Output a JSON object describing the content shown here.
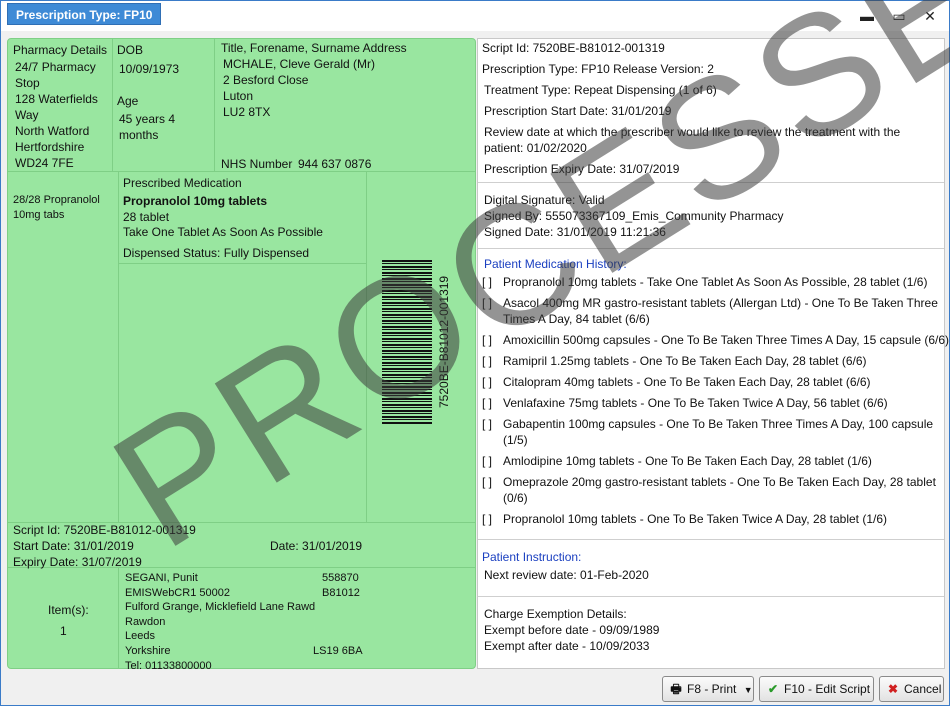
{
  "window": {
    "title": "Prescription Type: FP10",
    "minimize_icon": "▬",
    "maximize_icon": "▭",
    "close_icon": "✕"
  },
  "pharmacy": {
    "header": "Pharmacy Details",
    "lines": [
      "24/7 Pharmacy",
      "Stop",
      "128 Waterfields",
      "Way",
      "North Watford",
      "Hertfordshire",
      "WD24 7FE"
    ]
  },
  "patient": {
    "dob_label": "DOB",
    "dob": "10/09/1973",
    "age_label": "Age",
    "age_line1": "45 years 4",
    "age_line2": "months",
    "name_header": "Title, Forename, Surname Address",
    "name": "MCHALE, Cleve Gerald (Mr)",
    "address": [
      "2 Besford Close",
      "Luton",
      "LU2 8TX"
    ],
    "nhs_label": "NHS Number",
    "nhs_number": "944 637 0876"
  },
  "dispensed": {
    "line1": "28/28 Propranolol",
    "line2": "10mg tabs"
  },
  "medication": {
    "header": "Prescribed Medication",
    "name": "Propranolol 10mg tablets",
    "quantity": "28 tablet",
    "dosage": "Take One Tablet As Soon As Possible",
    "status": "Dispensed Status: Fully Dispensed",
    "barcode_text": "7520BE-B81012-001319"
  },
  "script_footer": {
    "script_id": "Script Id:  7520BE-B81012-001319",
    "start_date": "Start Date:  31/01/2019",
    "expiry_date": "Expiry Date:  31/07/2019",
    "date": "Date:  31/01/2019"
  },
  "prescriber": {
    "items_label": "Item(s):",
    "items_count": "1",
    "name": "SEGANI, Punit",
    "code1": "558870",
    "org": "EMISWebCR1 50002",
    "code2": "B81012",
    "address1": "Fulford Grange, Micklefield Lane Rawd",
    "address2": "Rawdon",
    "address3": "Leeds",
    "address4": "Yorkshire",
    "postcode": "LS19 6BA",
    "tel": "Tel: 01133800000"
  },
  "details": {
    "script_id": "Script Id:   7520BE-B81012-001319",
    "prescription_type": "Prescription Type:  FP10  Release Version:   2",
    "treatment_type": "Treatment Type: Repeat Dispensing (1 of 6)",
    "start_date": "Prescription Start Date: 31/01/2019",
    "review_line1": "Review date at which the prescriber would like to review the treatment with the",
    "review_line2": "patient: 01/02/2020",
    "expiry_date": "Prescription Expiry Date: 31/07/2019"
  },
  "signature": {
    "valid": "Digital Signature: Valid",
    "signed_by": "Signed By: 555073367109_Emis_Community Pharmacy",
    "signed_date": "Signed Date: 31/01/2019 11:21:36"
  },
  "history": {
    "header": "Patient Medication History:",
    "checkbox": "[  ]",
    "items": [
      {
        "l1": "Propranolol 10mg tablets - Take One Tablet As Soon As Possible, 28 tablet (1/6)",
        "l2": ""
      },
      {
        "l1": "Asacol 400mg MR gastro-resistant tablets (Allergan Ltd) - One To Be Taken Three",
        "l2": "Times A Day, 84 tablet (6/6)"
      },
      {
        "l1": "Amoxicillin 500mg capsules - One To Be Taken Three Times A Day, 15 capsule (6/6)",
        "l2": ""
      },
      {
        "l1": "Ramipril 1.25mg tablets - One To Be Taken Each Day, 28 tablet (6/6)",
        "l2": ""
      },
      {
        "l1": "Citalopram 40mg tablets - One To Be Taken Each Day, 28 tablet (6/6)",
        "l2": ""
      },
      {
        "l1": "Venlafaxine 75mg tablets - One To Be Taken Twice A Day, 56 tablet (6/6)",
        "l2": ""
      },
      {
        "l1": "Gabapentin 100mg capsules - One To Be Taken Three Times A Day, 100 capsule",
        "l2": "(1/5)"
      },
      {
        "l1": "Amlodipine 10mg tablets - One To Be Taken Each Day, 28 tablet (1/6)",
        "l2": ""
      },
      {
        "l1": "Omeprazole 20mg gastro-resistant tablets - One To Be Taken Each Day, 28 tablet",
        "l2": "(0/6)"
      },
      {
        "l1": "Propranolol 10mg tablets - One To Be Taken Twice A Day, 28 tablet (1/6)",
        "l2": ""
      }
    ]
  },
  "instruction": {
    "header": "Patient Instruction:",
    "text": "Next review date: 01-Feb-2020"
  },
  "charge": {
    "header": "Charge Exemption Details:",
    "before": "Exempt before date - 09/09/1989",
    "after": "Exempt after date - 10/09/2033"
  },
  "watermark": "PROCESSED",
  "buttons": {
    "print": "F8 - Print",
    "edit": "F10 - Edit Script",
    "cancel": "Cancel",
    "print_icon": "🖶",
    "dropdown_icon": "▼",
    "edit_icon": "✔",
    "cancel_icon": "✖"
  },
  "colors": {
    "panel_green": "#99e6a0",
    "title_blue": "#3e8ad6",
    "link_blue": "#1a3fc0"
  }
}
